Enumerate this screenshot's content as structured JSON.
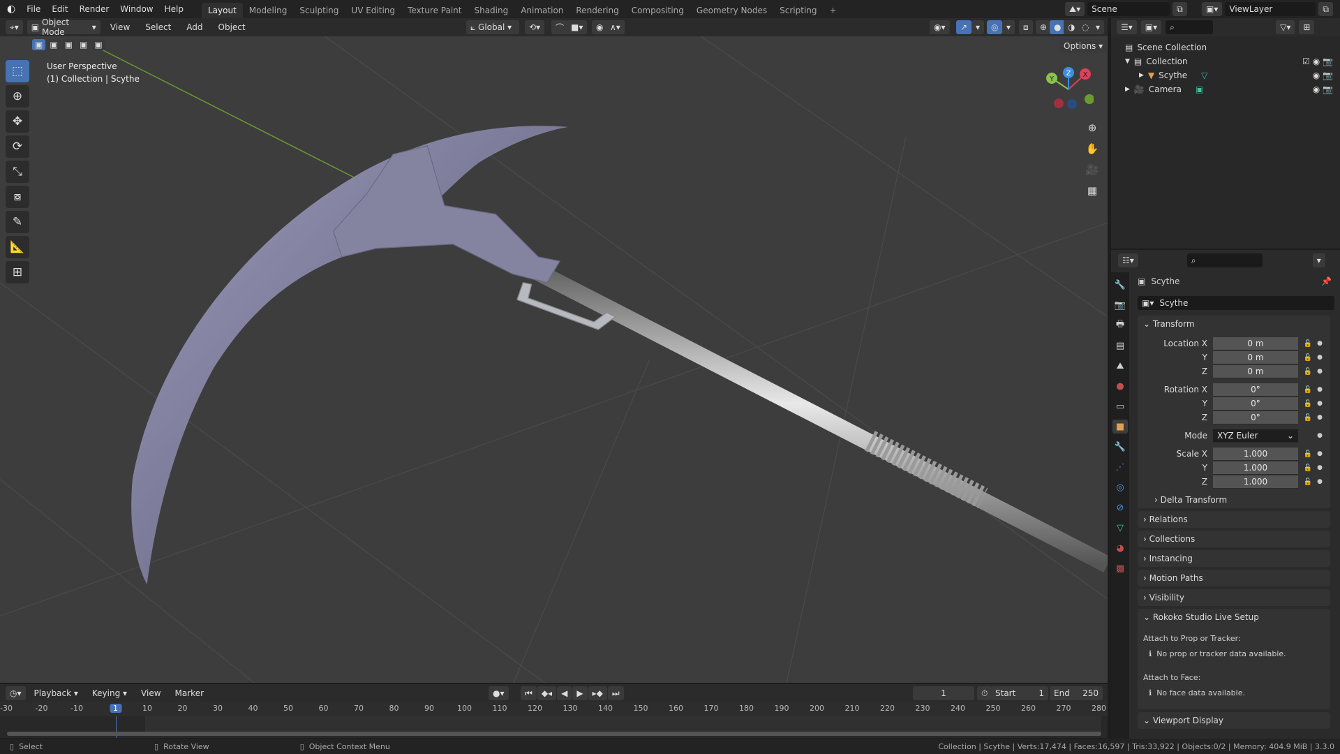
{
  "topbar": {
    "menus": [
      "File",
      "Edit",
      "Render",
      "Window",
      "Help"
    ],
    "workspaces": [
      "Layout",
      "Modeling",
      "Sculpting",
      "UV Editing",
      "Texture Paint",
      "Shading",
      "Animation",
      "Rendering",
      "Compositing",
      "Geometry Nodes",
      "Scripting"
    ],
    "active_workspace": "Layout",
    "add_tab": "+",
    "scene": "Scene",
    "view_layer": "ViewLayer"
  },
  "viewport_header": {
    "mode": "Object Mode",
    "menus": [
      "View",
      "Select",
      "Add",
      "Object"
    ],
    "orientation": "Global",
    "options": "Options"
  },
  "viewport": {
    "perspective": "User Perspective",
    "context": "(1) Collection | Scythe",
    "gizmo_axes": [
      "X",
      "Y",
      "Z"
    ],
    "colors": {
      "x_axis": "#e0405a",
      "y_axis": "#8bc34a",
      "z_axis": "#3f8fe0",
      "accent": "#4772b3"
    }
  },
  "outliner": {
    "root": "Scene Collection",
    "items": [
      {
        "name": "Collection",
        "level": 1
      },
      {
        "name": "Scythe",
        "level": 2
      },
      {
        "name": "Camera",
        "level": 1
      }
    ]
  },
  "properties": {
    "object_name": "Scythe",
    "datablock": "Scythe",
    "transform": {
      "title": "Transform",
      "location": {
        "label": "Location X",
        "x": "0 m",
        "y": "0 m",
        "z": "0 m"
      },
      "rotation": {
        "label": "Rotation X",
        "x": "0°",
        "y": "0°",
        "z": "0°"
      },
      "mode_label": "Mode",
      "mode": "XYZ Euler",
      "scale": {
        "label": "Scale X",
        "x": "1.000",
        "y": "1.000",
        "z": "1.000"
      },
      "axis_y": "Y",
      "axis_z": "Z"
    },
    "delta_transform": "Delta Transform",
    "collapsed_panels": [
      "Relations",
      "Collections",
      "Instancing",
      "Motion Paths",
      "Visibility"
    ],
    "rokoko": {
      "title": "Rokoko Studio Live Setup",
      "prop_label": "Attach to Prop or Tracker:",
      "prop_info": "No prop or tracker data available.",
      "face_label": "Attach to Face:",
      "face_info": "No face data available."
    },
    "viewport_display": "Viewport Display"
  },
  "timeline": {
    "menus": [
      "Playback",
      "Keying",
      "View",
      "Marker"
    ],
    "current_frame": "1",
    "start_label": "Start",
    "start": "1",
    "end_label": "End",
    "end": "250",
    "ticks": [
      -30,
      -20,
      -10,
      1,
      10,
      20,
      30,
      40,
      50,
      60,
      70,
      80,
      90,
      100,
      110,
      120,
      130,
      140,
      150,
      160,
      170,
      180,
      190,
      200,
      210,
      220,
      230,
      240,
      250,
      260,
      270,
      280
    ]
  },
  "statusbar": {
    "hints": [
      "Select",
      "Rotate View",
      "Object Context Menu"
    ],
    "stats": "Collection | Scythe | Verts:17,474 | Faces:16,597 | Tris:33,922 | Objects:0/2 | Memory: 404.9 MiB | 3.3.0"
  }
}
